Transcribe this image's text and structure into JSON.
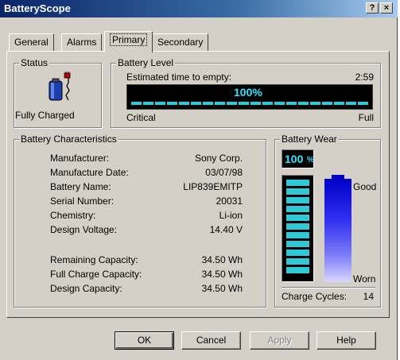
{
  "window": {
    "title": "BatteryScope",
    "help_button": "?",
    "close_button": "×"
  },
  "tabs": [
    {
      "label": "General"
    },
    {
      "label": "Alarms"
    },
    {
      "label": "Primary",
      "active": true
    },
    {
      "label": "Secondary"
    }
  ],
  "status": {
    "group_label": "Status",
    "text": "Fully Charged",
    "icon": "battery-plug-icon"
  },
  "battery_level": {
    "group_label": "Battery Level",
    "estimated_label": "Estimated time to empty:",
    "estimated_value": "2:59",
    "percent_text": "100%",
    "percent": 100,
    "low_label": "Critical",
    "high_label": "Full"
  },
  "characteristics": {
    "group_label": "Battery Characteristics",
    "rows": [
      {
        "label": "Manufacturer:",
        "value": "Sony Corp."
      },
      {
        "label": "Manufacture Date:",
        "value": "03/07/98"
      },
      {
        "label": "Battery Name:",
        "value": "LIP839EMITP"
      },
      {
        "label": "Serial Number:",
        "value": "20031"
      },
      {
        "label": "Chemistry:",
        "value": "Li-ion"
      },
      {
        "label": "Design Voltage:",
        "value": "14.40 V"
      }
    ],
    "capacity_rows": [
      {
        "label": "Remaining Capacity:",
        "value": "34.50 Wh"
      },
      {
        "label": "Full Charge Capacity:",
        "value": "34.50 Wh"
      },
      {
        "label": "Design Capacity:",
        "value": "34.50 Wh"
      }
    ]
  },
  "wear": {
    "group_label": "Battery Wear",
    "percent_text": "100",
    "percent_suffix": "%",
    "percent": 100,
    "good_label": "Good",
    "worn_label": "Worn",
    "cycles_label": "Charge Cycles:",
    "cycles_value": "14"
  },
  "buttons": {
    "ok": "OK",
    "cancel": "Cancel",
    "apply": "Apply",
    "help": "Help"
  },
  "colors": {
    "title_bar": "#0a246a",
    "dialog_face": "#d4d0c8",
    "gauge_segment": "#2ec8d6",
    "gauge_text": "#2ee8ff",
    "wear_gradient_top": "#0000c8",
    "wear_gradient_bottom": "#c8c8ff"
  }
}
